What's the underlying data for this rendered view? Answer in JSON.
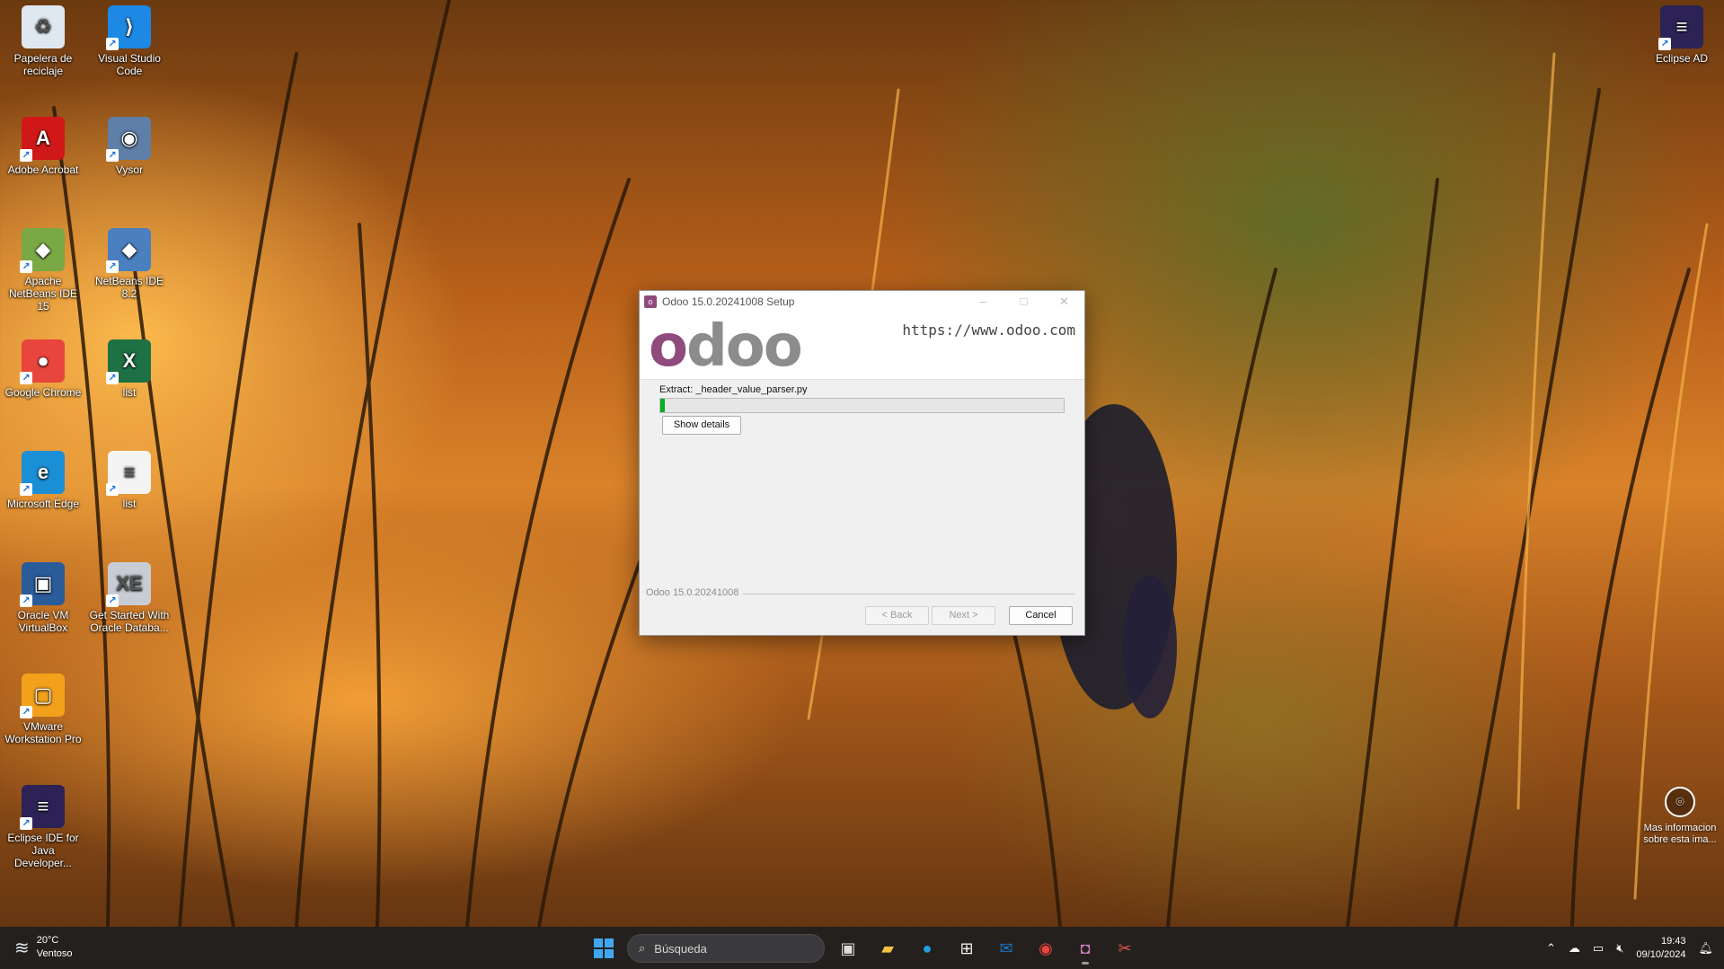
{
  "desktop": {
    "icons": [
      {
        "label": "Papelera de reciclaje",
        "glyph": "♻",
        "color": "#dfe8f0"
      },
      {
        "label": "Visual Studio Code",
        "glyph": "⟩",
        "color": "#1e88e5"
      },
      {
        "label": "Adobe Acrobat",
        "glyph": "A",
        "color": "#d01818"
      },
      {
        "label": "Vysor",
        "glyph": "◉",
        "color": "#5d7fa8"
      },
      {
        "label": "Apache NetBeans IDE 15",
        "glyph": "◆",
        "color": "#7aa844"
      },
      {
        "label": "NetBeans IDE 8.2",
        "glyph": "◆",
        "color": "#4a7fc0"
      },
      {
        "label": "Google Chrome",
        "glyph": "●",
        "color": "#e8453c"
      },
      {
        "label": "list",
        "glyph": "X",
        "color": "#1e7145"
      },
      {
        "label": "Microsoft Edge",
        "glyph": "e",
        "color": "#1b8fd6"
      },
      {
        "label": "list",
        "glyph": "≡",
        "color": "#f4f4f4"
      },
      {
        "label": "Oracle VM VirtualBox",
        "glyph": "▣",
        "color": "#2b5c9a"
      },
      {
        "label": "Get Started With Oracle Databa...",
        "glyph": "XE",
        "color": "#c8ccd4"
      },
      {
        "label": "VMware Workstation Pro",
        "glyph": "▢",
        "color": "#f3a11b"
      },
      {
        "label": "Eclipse IDE for Java Developer...",
        "glyph": "≡",
        "color": "#2c2255"
      },
      {
        "label": "Eclipse AD",
        "glyph": "≡",
        "color": "#2c2255"
      }
    ],
    "info_badge": {
      "label": "Mas informacion sobre esta ima..."
    }
  },
  "installer": {
    "title": "Odoo 15.0.20241008 Setup",
    "logo_first": "o",
    "logo_rest": "doo",
    "url": "https://www.odoo.com",
    "status": "Extract: _header_value_parser.py",
    "progress_fraction": 0.012,
    "show_details": "Show details",
    "footer_label": "Odoo 15.0.20241008",
    "back": "< Back",
    "next": "Next >",
    "cancel": "Cancel",
    "minimize": "–",
    "maximize": "□",
    "close": "✕"
  },
  "taskbar": {
    "temperature": "20°C",
    "condition": "Ventoso",
    "search_placeholder": "Búsqueda",
    "time": "19:43",
    "date": "09/10/2024"
  }
}
